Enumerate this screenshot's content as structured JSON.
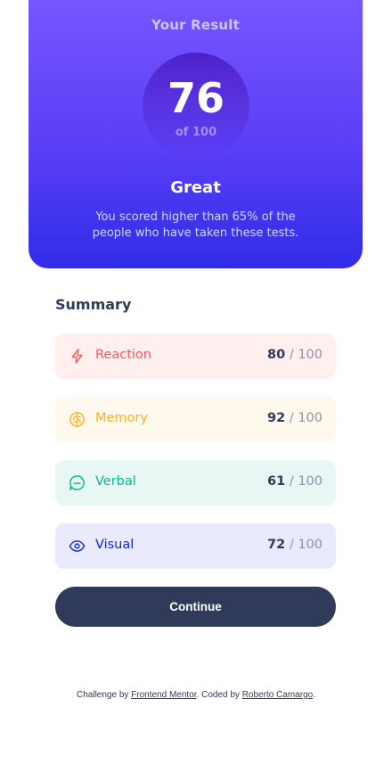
{
  "result": {
    "heading": "Your Result",
    "score": "76",
    "of_label": "of 100",
    "rating": "Great",
    "description": "You scored higher than 65% of the people who have taken these tests."
  },
  "summary": {
    "title": "Summary",
    "items": [
      {
        "label": "Reaction",
        "score": "80",
        "of": " / 100",
        "icon": "lightning-icon",
        "color": "#FF5757"
      },
      {
        "label": "Memory",
        "score": "92",
        "of": " / 100",
        "icon": "brain-icon",
        "color": "#FFB01F"
      },
      {
        "label": "Verbal",
        "score": "61",
        "of": " / 100",
        "icon": "speech-bubble-icon",
        "color": "#00BB8F"
      },
      {
        "label": "Visual",
        "score": "72",
        "of": " / 100",
        "icon": "eye-icon",
        "color": "#1125D4"
      }
    ],
    "continue_label": "Continue"
  },
  "attribution": {
    "prefix": "Challenge by ",
    "challenge_link": "Frontend Mentor",
    "middle": ". Coded by ",
    "author_link": "Roberto Camargo",
    "suffix": "."
  }
}
